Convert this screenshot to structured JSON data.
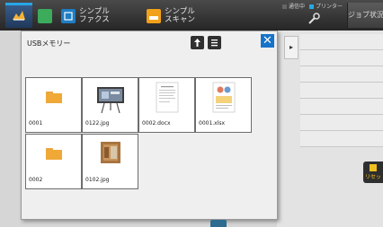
{
  "topbar": {
    "apps": [
      {
        "label": "シンプル\nファクス",
        "color": "#1f7ec4"
      },
      {
        "label": "シンプル\nスキャン",
        "color": "#f2a11a"
      }
    ],
    "status": {
      "comm": "通信中",
      "printer": "プリンター"
    },
    "job_button": "ジョブ状況"
  },
  "modal": {
    "title": "USBメモリー",
    "files": [
      {
        "name": "0001",
        "kind": "folder"
      },
      {
        "name": "0122.jpg",
        "kind": "image"
      },
      {
        "name": "0002.docx",
        "kind": "document"
      },
      {
        "name": "0001.xlsx",
        "kind": "spreadsheet"
      },
      {
        "name": "0002",
        "kind": "folder"
      },
      {
        "name": "0102.jpg",
        "kind": "image"
      }
    ]
  },
  "side": {
    "reset_label": "リセット"
  },
  "colors": {
    "accent": "#1673c9",
    "folder": "#f0a836"
  }
}
